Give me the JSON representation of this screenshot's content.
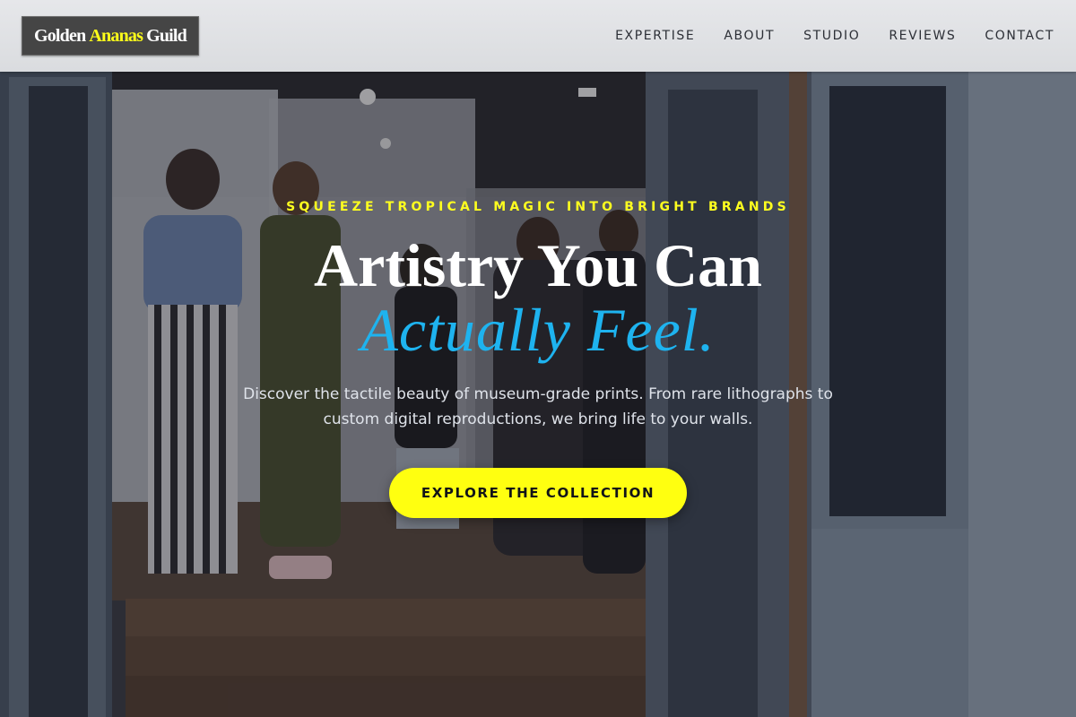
{
  "header": {
    "logo": {
      "word1": "Golden",
      "word2": "Ananas",
      "word3": "Guild"
    },
    "nav": [
      {
        "label": "EXPERTISE"
      },
      {
        "label": "ABOUT"
      },
      {
        "label": "STUDIO"
      },
      {
        "label": "REVIEWS"
      },
      {
        "label": "CONTACT"
      }
    ]
  },
  "hero": {
    "kicker": "SQUEEZE TROPICAL MAGIC INTO BRIGHT BRANDS",
    "headline_line1": "Artistry You Can",
    "headline_line2": "Actually Feel.",
    "subtext": "Discover the tactile beauty of museum-grade prints. From rare lithographs to custom digital reproductions, we bring life to your walls.",
    "cta_label": "EXPLORE THE COLLECTION",
    "background": "photo of people inside a gallery viewed through open doors"
  },
  "colors": {
    "accent_yellow": "#ffff10",
    "accent_blue": "#1eb3ef",
    "header_bg": "#e0e1e4",
    "logo_bg": "#454545"
  }
}
